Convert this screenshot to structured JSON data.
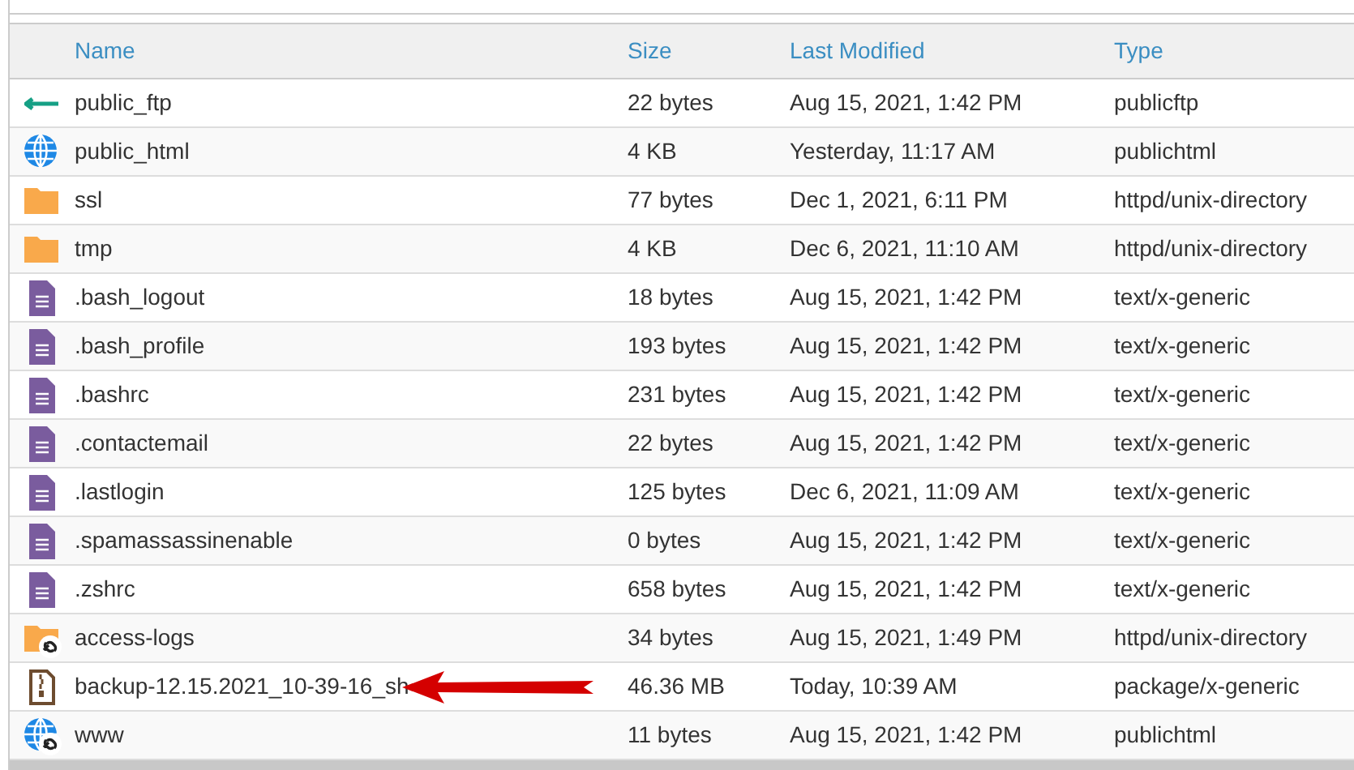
{
  "columns": [
    "Name",
    "Size",
    "Last Modified",
    "Type"
  ],
  "rows": [
    {
      "kind": "ftp",
      "name": "public_ftp",
      "size": "22 bytes",
      "modified": "Aug 15, 2021, 1:42 PM",
      "type": "publicftp"
    },
    {
      "kind": "web",
      "name": "public_html",
      "size": "4 KB",
      "modified": "Yesterday, 11:17 AM",
      "type": "publichtml"
    },
    {
      "kind": "folder",
      "name": "ssl",
      "size": "77 bytes",
      "modified": "Dec 1, 2021, 6:11 PM",
      "type": "httpd/unix-directory"
    },
    {
      "kind": "folder",
      "name": "tmp",
      "size": "4 KB",
      "modified": "Dec 6, 2021, 11:10 AM",
      "type": "httpd/unix-directory"
    },
    {
      "kind": "text",
      "name": ".bash_logout",
      "size": "18 bytes",
      "modified": "Aug 15, 2021, 1:42 PM",
      "type": "text/x-generic"
    },
    {
      "kind": "text",
      "name": ".bash_profile",
      "size": "193 bytes",
      "modified": "Aug 15, 2021, 1:42 PM",
      "type": "text/x-generic"
    },
    {
      "kind": "text",
      "name": ".bashrc",
      "size": "231 bytes",
      "modified": "Aug 15, 2021, 1:42 PM",
      "type": "text/x-generic"
    },
    {
      "kind": "text",
      "name": ".contactemail",
      "size": "22 bytes",
      "modified": "Aug 15, 2021, 1:42 PM",
      "type": "text/x-generic"
    },
    {
      "kind": "text",
      "name": ".lastlogin",
      "size": "125 bytes",
      "modified": "Dec 6, 2021, 11:09 AM",
      "type": "text/x-generic"
    },
    {
      "kind": "text",
      "name": ".spamassassinenable",
      "size": "0 bytes",
      "modified": "Aug 15, 2021, 1:42 PM",
      "type": "text/x-generic"
    },
    {
      "kind": "text",
      "name": ".zshrc",
      "size": "658 bytes",
      "modified": "Aug 15, 2021, 1:42 PM",
      "type": "text/x-generic"
    },
    {
      "kind": "folder-link",
      "name": "access-logs",
      "size": "34 bytes",
      "modified": "Aug 15, 2021, 1:49 PM",
      "type": "httpd/unix-directory"
    },
    {
      "kind": "archive",
      "name": "backup-12.15.2021_10-39-16_sh",
      "size": "46.36 MB",
      "modified": "Today, 10:39 AM",
      "type": "package/x-generic",
      "annotated": true
    },
    {
      "kind": "web-link",
      "name": "www",
      "size": "11 bytes",
      "modified": "Aug 15, 2021, 1:42 PM",
      "type": "publichtml"
    }
  ]
}
